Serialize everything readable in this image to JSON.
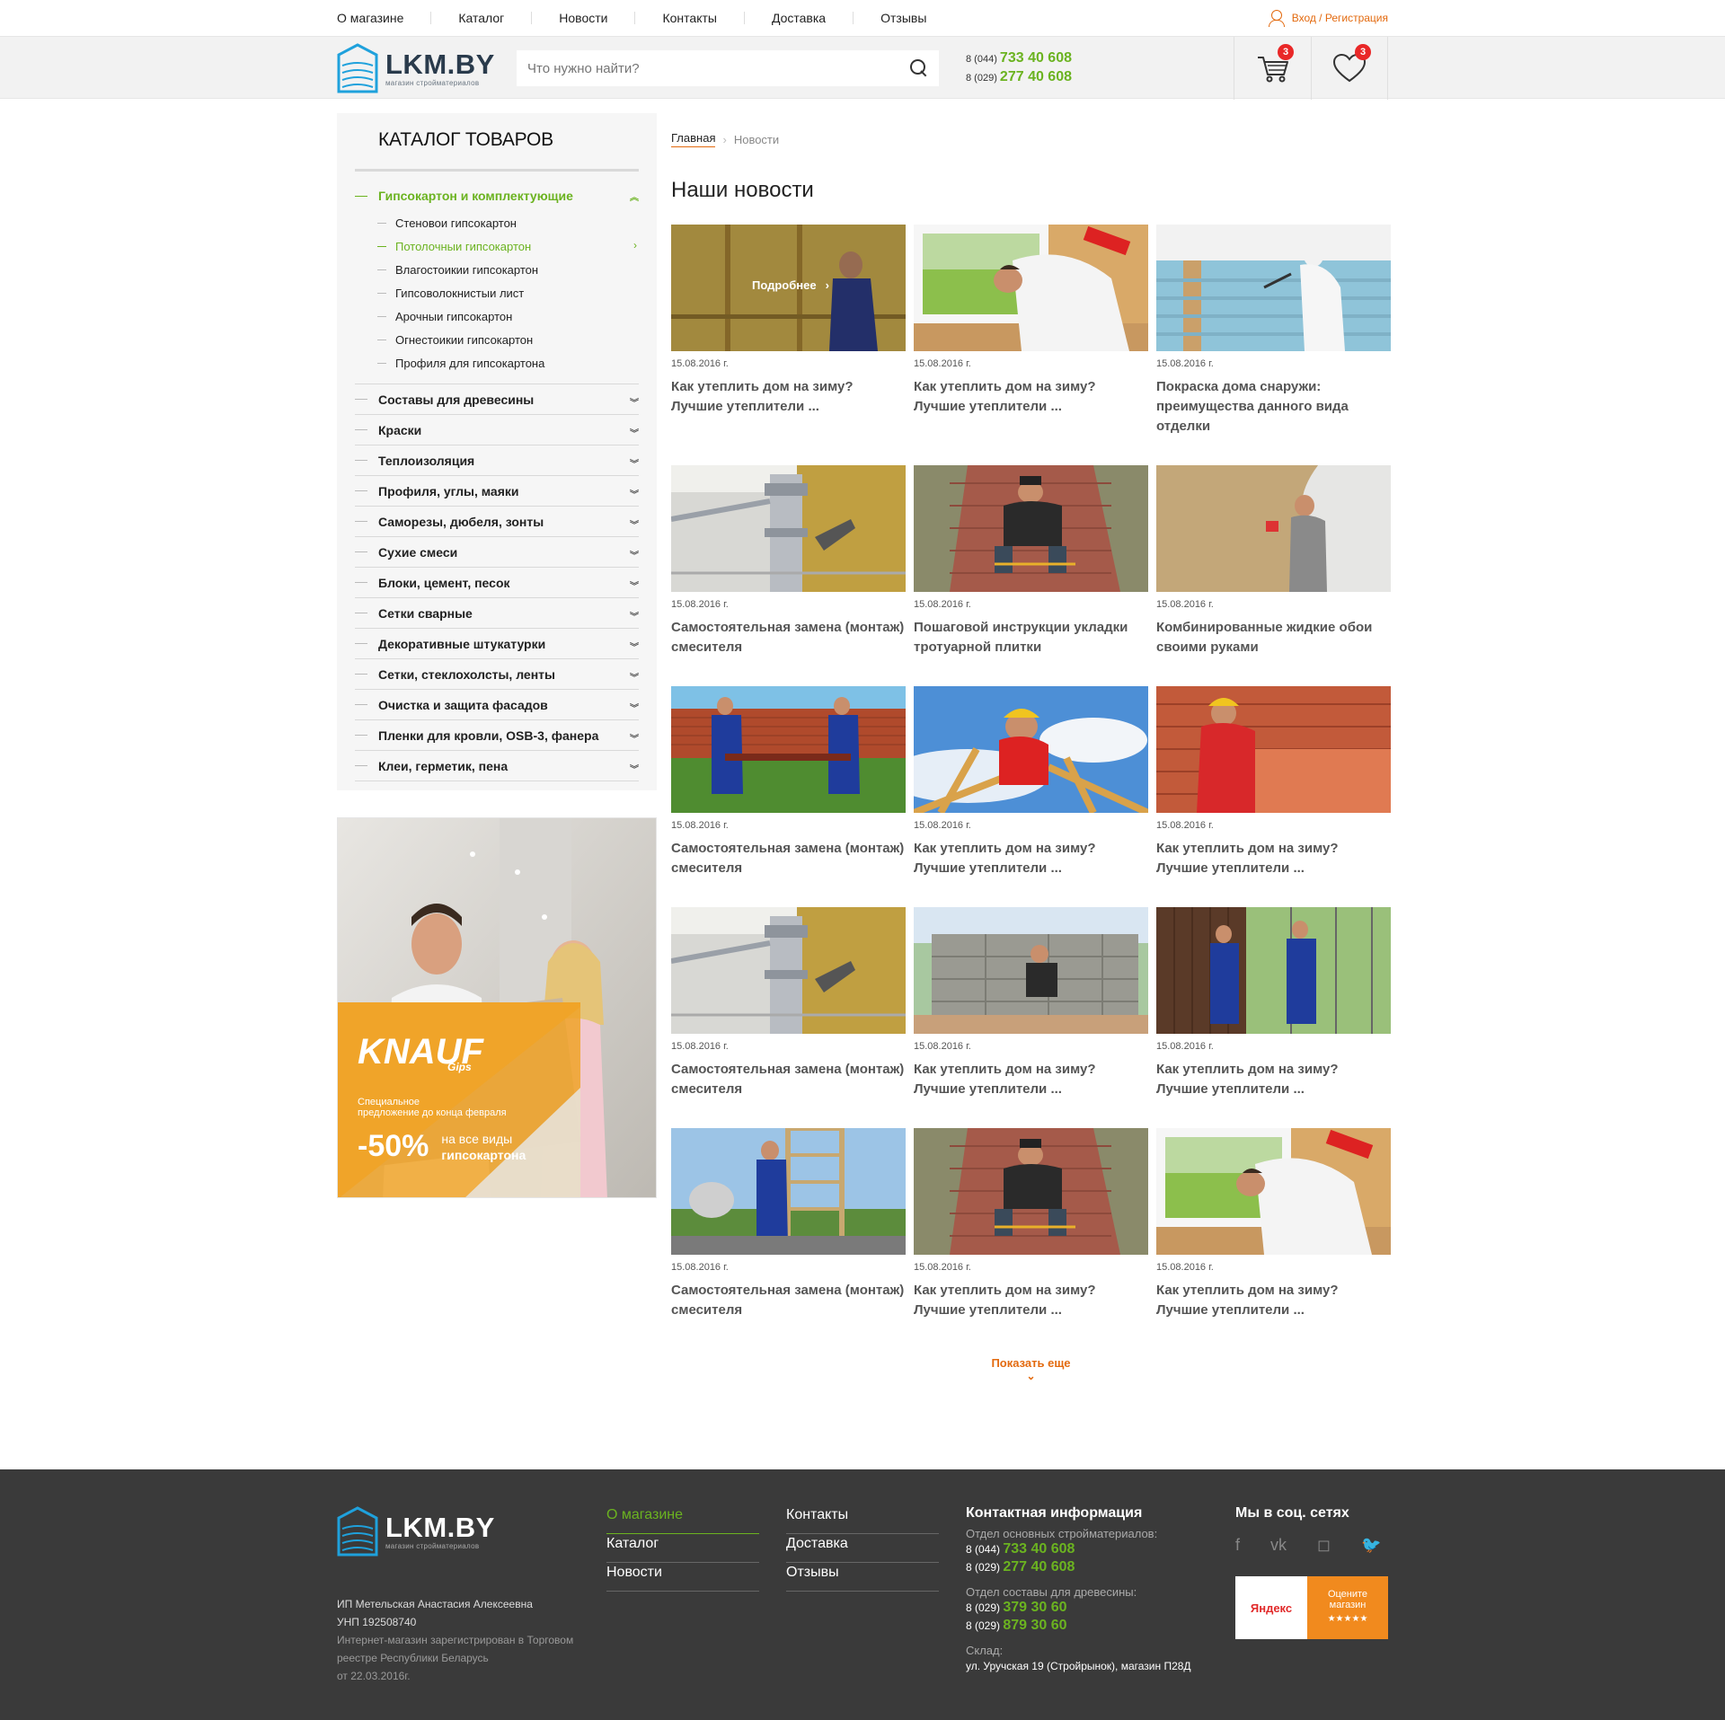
{
  "topnav": {
    "items": [
      "О магазине",
      "Каталог",
      "Новости",
      "Контакты",
      "Доставка",
      "Отзывы"
    ],
    "login": "Вход / Регистрация"
  },
  "header": {
    "logo_name": "LKM.BY",
    "logo_sub": "магазин стройматериалов",
    "search_placeholder": "Что нужно найти?",
    "phone1_prefix": "8 (044)",
    "phone1_number": "733 40 608",
    "phone2_prefix": "8 (029)",
    "phone2_number": "277 40 608",
    "cart_count": "3",
    "favorites_count": "3"
  },
  "catalog": {
    "title": "КАТАЛОГ ТОВАРОВ",
    "open_category": "Гипсокартон и комплектующие",
    "subitems": [
      "Стеновои гипсокартон",
      "Потолочныи гипсокартон",
      "Влагостоикии гипсокартон",
      "Гипсоволокнистыи лист",
      "Арочныи гипсокартон",
      "Огнестоикии гипсокартон",
      "Профиля для гипсокартона"
    ],
    "active_subitem_index": 1,
    "categories": [
      "Составы для древесины",
      "Краски",
      "Теплоизоляция",
      "Профиля, углы, маяки",
      "Саморезы, дюбеля, зонты",
      "Сухие смеси",
      "Блоки, цемент, песок",
      "Сетки сварные",
      "Декоративные штукатурки",
      "Сетки, стеклохолсты, ленты",
      "Очистка и защита фасадов",
      "Пленки для кровли, OSB-3, фанера",
      "Клеи, герметик, пена"
    ]
  },
  "banner": {
    "brand": "KNAUF",
    "brand_sub": "Gips",
    "offer_line1": "Специальное",
    "offer_line2": "предложение до конца февраля",
    "discount": "-50%",
    "discount_line1": "на все виды",
    "discount_line2": "гипсокартона"
  },
  "breadcrumb": {
    "home": "Главная",
    "current": "Новости"
  },
  "page_title": "Наши новости",
  "more_label": "Подробнее",
  "news": [
    {
      "date": "15.08.2016 г.",
      "title": "Как утеплить дом на зиму? Лучшие утеплители ...",
      "scene": "insulation",
      "hover": true
    },
    {
      "date": "15.08.2016 г.",
      "title": "Как утеплить дом на зиму? Лучшие утеплители ...",
      "scene": "window"
    },
    {
      "date": "15.08.2016 г.",
      "title": "Покраска дома снаружи: преимущества данного вида отделки",
      "scene": "painting"
    },
    {
      "date": "15.08.2016 г.",
      "title": "Самостоятельная замена (монтаж) смесителя",
      "scene": "plumbing"
    },
    {
      "date": "15.08.2016 г.",
      "title": "Пошаговой инструкции укладки тротуарной плитки",
      "scene": "paving"
    },
    {
      "date": "15.08.2016 г.",
      "title": "Комбинированные жидкие обои своими руками",
      "scene": "wallpaper"
    },
    {
      "date": "15.08.2016 г.",
      "title": "Самостоятельная замена (монтаж) смесителя",
      "scene": "fence"
    },
    {
      "date": "15.08.2016 г.",
      "title": "Как утеплить дом на зиму? Лучшие утеплители ...",
      "scene": "roof"
    },
    {
      "date": "15.08.2016 г.",
      "title": "Как утеплить дом на зиму? Лучшие утеплители ...",
      "scene": "bricks"
    },
    {
      "date": "15.08.2016 г.",
      "title": "Самостоятельная замена (монтаж) смесителя",
      "scene": "plumbing"
    },
    {
      "date": "15.08.2016 г.",
      "title": "Как утеплить дом на зиму? Лучшие утеплители ...",
      "scene": "blocks"
    },
    {
      "date": "15.08.2016 г.",
      "title": "Как утеплить дом на зиму? Лучшие утеплители ...",
      "scene": "fence2"
    },
    {
      "date": "15.08.2016 г.",
      "title": "Самостоятельная замена (монтаж) смесителя",
      "scene": "mixer"
    },
    {
      "date": "15.08.2016 г.",
      "title": "Как утеплить дом на зиму? Лучшие утеплители ...",
      "scene": "paving"
    },
    {
      "date": "15.08.2016 г.",
      "title": "Как утеплить дом на зиму? Лучшие утеплители ...",
      "scene": "window"
    }
  ],
  "show_more": "Показать еще",
  "footer": {
    "logo_name": "LKM.BY",
    "logo_sub": "магазин стройматериалов",
    "owner": "ИП Метельская Анастасия Алексеевна",
    "unp": "УНП 192508740",
    "reg_line1": "Интернет-магазин зарегистрирован в Торговом",
    "reg_line2": "реестре Республики Беларусь",
    "reg_line3": "от 22.03.2016г.",
    "menu1": [
      "О магазине",
      "Каталог",
      "Новости"
    ],
    "menu2": [
      "Контакты",
      "Доставка",
      "Отзывы"
    ],
    "contacts_title": "Контактная информация",
    "dept1": "Отдел основных стройматериалов:",
    "dept1_p1_prefix": "8 (044)",
    "dept1_p1": "733 40 608",
    "dept1_p2_prefix": "8 (029)",
    "dept1_p2": "277 40 608",
    "dept2": "Отдел составы для древесины:",
    "dept2_p1_prefix": "8 (029)",
    "dept2_p1": "379 30 60",
    "dept2_p2_prefix": "8 (029)",
    "dept2_p2": "879 30 60",
    "warehouse": "Склад:",
    "warehouse_addr": "ул. Уручская 19 (Стройрынок), магазин П28Д",
    "social_title": "Мы в соц. сетях",
    "yandex_label": "Яндекс",
    "yandex_rate_line1": "Оцените",
    "yandex_rate_line2": "магазин",
    "yandex_stars": "★★★★★"
  },
  "colors": {
    "accent_green": "#6bb320",
    "accent_orange": "#e36a0f",
    "badge_red": "#e92727",
    "footer_bg": "#3a3a3a"
  }
}
